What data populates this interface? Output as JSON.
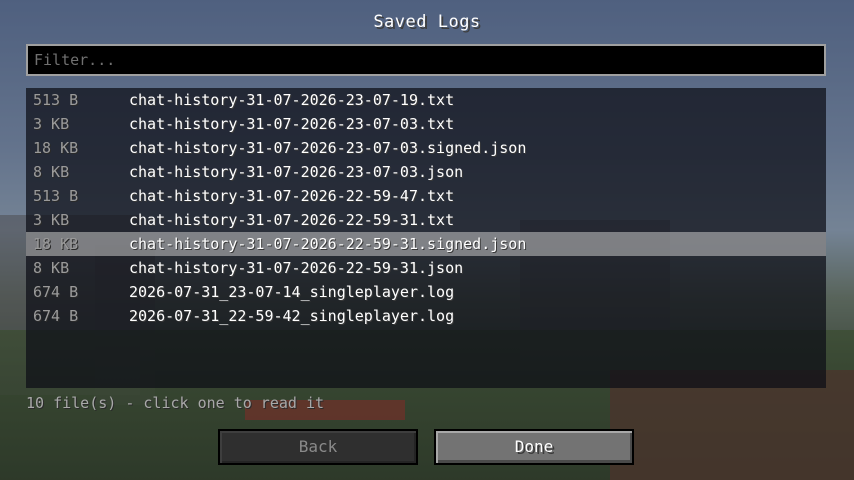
{
  "screen": {
    "title": "Saved Logs"
  },
  "filter": {
    "placeholder": "Filter...",
    "value": ""
  },
  "files": [
    {
      "size": "513 B",
      "name": "chat-history-31-07-2026-23-07-19.txt"
    },
    {
      "size": "3 KB",
      "name": "chat-history-31-07-2026-23-07-03.txt"
    },
    {
      "size": "18 KB",
      "name": "chat-history-31-07-2026-23-07-03.signed.json"
    },
    {
      "size": "8 KB",
      "name": "chat-history-31-07-2026-23-07-03.json"
    },
    {
      "size": "513 B",
      "name": "chat-history-31-07-2026-22-59-47.txt"
    },
    {
      "size": "3 KB",
      "name": "chat-history-31-07-2026-22-59-31.txt"
    },
    {
      "size": "18 KB",
      "name": "chat-history-31-07-2026-22-59-31.signed.json",
      "hovered": true
    },
    {
      "size": "8 KB",
      "name": "chat-history-31-07-2026-22-59-31.json"
    },
    {
      "size": "674 B",
      "name": "2026-07-31_23-07-14_singleplayer.log"
    },
    {
      "size": "674 B",
      "name": "2026-07-31_22-59-42_singleplayer.log"
    }
  ],
  "status": {
    "text": "10 file(s) - click one to read it"
  },
  "buttons": {
    "back_label": "Back",
    "done_label": "Done"
  }
}
